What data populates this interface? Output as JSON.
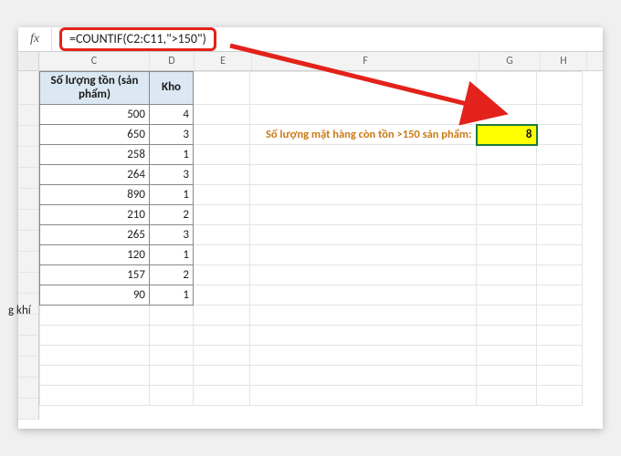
{
  "formula_bar": {
    "fx_label": "fx",
    "formula": "=COUNTIF(C2:C11,\">150\")"
  },
  "columns": [
    "C",
    "D",
    "E",
    "F",
    "G",
    "H"
  ],
  "headers": {
    "col_C": "Số lượng tồn (sản phẩm)",
    "col_D": "Kho"
  },
  "rows": [
    {
      "c": 500,
      "d": 4
    },
    {
      "c": 650,
      "d": 3
    },
    {
      "c": 258,
      "d": 1
    },
    {
      "c": 264,
      "d": 3
    },
    {
      "c": 890,
      "d": 1
    },
    {
      "c": 210,
      "d": 2
    },
    {
      "c": 265,
      "d": 3
    },
    {
      "c": 120,
      "d": 1
    },
    {
      "c": 157,
      "d": 2
    },
    {
      "c": 90,
      "d": 1
    }
  ],
  "truncated_label_row11": "g khí",
  "annotation": {
    "label": "Số lượng mặt hàng còn tồn >150 sản phẩm:",
    "result": 8
  },
  "colors": {
    "highlight_border": "#e3221b",
    "header_fill": "#dbe8f3",
    "result_fill": "#ffff00",
    "label_color": "#c97a14",
    "active_border": "#1e7a3a"
  }
}
